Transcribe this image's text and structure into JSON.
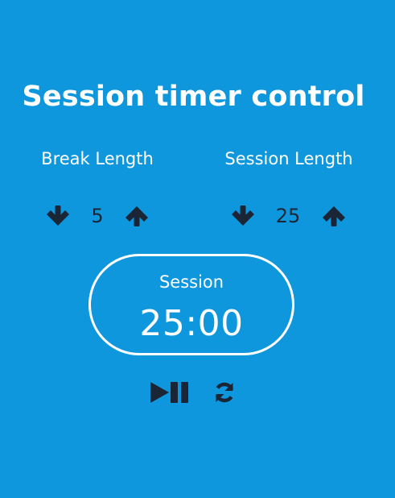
{
  "title": "Session timer control",
  "break": {
    "label": "Break Length",
    "value": "5",
    "decrement_icon": "arrow-down-icon",
    "increment_icon": "arrow-up-icon"
  },
  "session": {
    "label": "Session Length",
    "value": "25",
    "decrement_icon": "arrow-down-icon",
    "increment_icon": "arrow-up-icon"
  },
  "timer": {
    "label": "Session",
    "time": "25:00"
  },
  "controls": {
    "start_stop_icon": "play-pause-icon",
    "reset_icon": "refresh-icon"
  },
  "colors": {
    "background": "#0f97dd",
    "text": "#ffffff",
    "icon": "#1a2536"
  }
}
